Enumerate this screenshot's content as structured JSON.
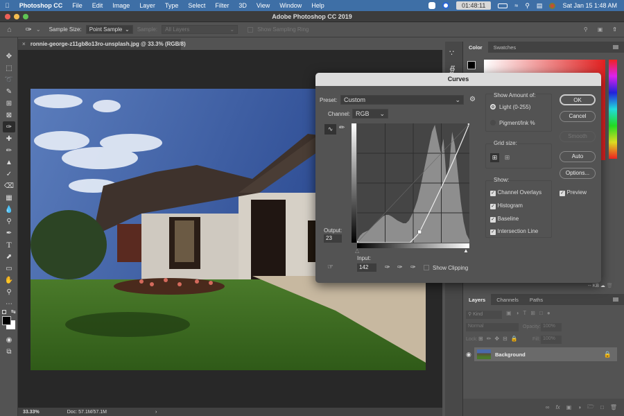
{
  "menubar": {
    "apple": "",
    "app": "Photoshop CC",
    "items": [
      "File",
      "Edit",
      "Image",
      "Layer",
      "Type",
      "Select",
      "Filter",
      "3D",
      "View",
      "Window",
      "Help"
    ],
    "timer": "01:48:11",
    "datetime": "Sat Jan 15  1:48 AM"
  },
  "window": {
    "title": "Adobe Photoshop CC 2019"
  },
  "options": {
    "sample_size_label": "Sample Size:",
    "sample_size_value": "Point Sample",
    "sample_label": "Sample:",
    "sample_value": "All Layers",
    "show_ring_label": "Show Sampling Ring"
  },
  "document": {
    "tab": "ronnie-george-z11gb8o13ro-unsplash.jpg @ 33.3% (RGB/8)",
    "zoom": "33.33%",
    "doc_size": "Doc: 57.1M/57.1M"
  },
  "color_panel": {
    "tabs": [
      "Color",
      "Swatches"
    ]
  },
  "layers_panel": {
    "tabs": [
      "Layers",
      "Channels",
      "Paths"
    ],
    "kind_placeholder": "Kind",
    "blend_mode": "Normal",
    "opacity_label": "Opacity:",
    "opacity_value": "100%",
    "lock_label": "Lock:",
    "fill_label": "Fill:",
    "fill_value": "100%",
    "layer_name": "Background",
    "kb_readout": "-- KB"
  },
  "curves": {
    "title": "Curves",
    "preset_label": "Preset:",
    "preset_value": "Custom",
    "channel_label": "Channel:",
    "channel_value": "RGB",
    "output_label": "Output:",
    "output_value": "23",
    "input_label": "Input:",
    "input_value": "142",
    "show_clipping_label": "Show Clipping",
    "show_amount_label": "Show Amount of:",
    "light_label": "Light  (0-255)",
    "pigment_label": "Pigment/Ink %",
    "grid_size_label": "Grid size:",
    "show_label": "Show:",
    "checks": [
      {
        "label": "Channel Overlays",
        "checked": true
      },
      {
        "label": "Histogram",
        "checked": true
      },
      {
        "label": "Baseline",
        "checked": true
      },
      {
        "label": "Intersection Line",
        "checked": true
      }
    ],
    "preview_label": "Preview",
    "buttons": {
      "ok": "OK",
      "cancel": "Cancel",
      "smooth": "Smooth",
      "auto": "Auto",
      "options": "Options..."
    },
    "curve_points": [
      [
        0,
        0
      ],
      [
        142,
        23
      ],
      [
        255,
        255
      ]
    ]
  }
}
